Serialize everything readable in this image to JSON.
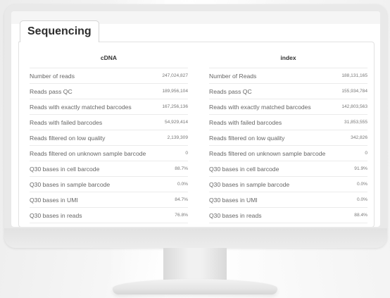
{
  "tab": {
    "label": "Sequencing"
  },
  "columns": [
    {
      "title": "cDNA",
      "rows": [
        {
          "label": "Number of reads",
          "value": "247,024,827"
        },
        {
          "label": "Reads pass QC",
          "value": "189,956,104"
        },
        {
          "label": "Reads with exactly matched barcodes",
          "value": "167,256,136"
        },
        {
          "label": "Reads with failed barcodes",
          "value": "54,929,414"
        },
        {
          "label": "Reads filtered on low quality",
          "value": "2,139,309"
        },
        {
          "label": "Reads filtered on unknown sample barcode",
          "value": "0"
        },
        {
          "label": "Q30 bases in cell barcode",
          "value": "88.7%"
        },
        {
          "label": "Q30 bases in sample barcode",
          "value": "0.0%"
        },
        {
          "label": "Q30 bases in UMI",
          "value": "84.7%"
        },
        {
          "label": "Q30 bases in reads",
          "value": "76.8%"
        }
      ]
    },
    {
      "title": "index",
      "rows": [
        {
          "label": "Number of Reads",
          "value": "188,131,165"
        },
        {
          "label": "Reads pass QC",
          "value": "155,934,784"
        },
        {
          "label": "Reads with exactly matched barcodes",
          "value": "142,803,563"
        },
        {
          "label": "Reads with failed barcodes",
          "value": "31,853,555"
        },
        {
          "label": "Reads filtered on low quality",
          "value": "342,826"
        },
        {
          "label": "Reads filtered on unknown sample barcode",
          "value": "0"
        },
        {
          "label": "Q30 bases in cell barcode",
          "value": "91.9%"
        },
        {
          "label": "Q30 bases in sample barcode",
          "value": "0.0%"
        },
        {
          "label": "Q30 bases in UMI",
          "value": "0.0%"
        },
        {
          "label": "Q30 bases in reads",
          "value": "88.4%"
        }
      ]
    }
  ]
}
